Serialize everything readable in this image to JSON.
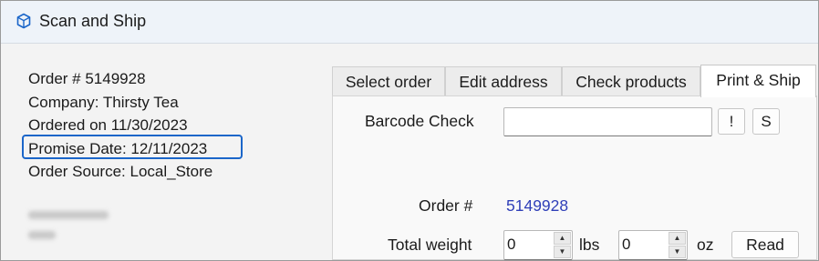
{
  "window": {
    "title": "Scan and Ship",
    "icon": "app-cube-icon"
  },
  "order_info": {
    "order_number": "Order # 5149928",
    "company": "Company: Thirsty Tea",
    "ordered_on": "Ordered on 11/30/2023",
    "promise_date": "Promise Date: 12/11/2023",
    "order_source": "Order Source: Local_Store",
    "highlight_color": "#1b66c9"
  },
  "tabs": [
    {
      "label": "Select order",
      "active": false
    },
    {
      "label": "Edit address",
      "active": false
    },
    {
      "label": "Check products",
      "active": false
    },
    {
      "label": "Print & Ship",
      "active": true
    }
  ],
  "print_ship": {
    "barcode_label": "Barcode Check",
    "barcode_value": "",
    "exclaim_button": "!",
    "s_button": "S",
    "order_label": "Order #",
    "order_value": "5149928",
    "order_value_color": "#2f3fb8",
    "weight_label": "Total weight",
    "lbs_value": "0",
    "lbs_unit": "lbs",
    "oz_value": "0",
    "oz_unit": "oz",
    "read_button": "Read"
  }
}
